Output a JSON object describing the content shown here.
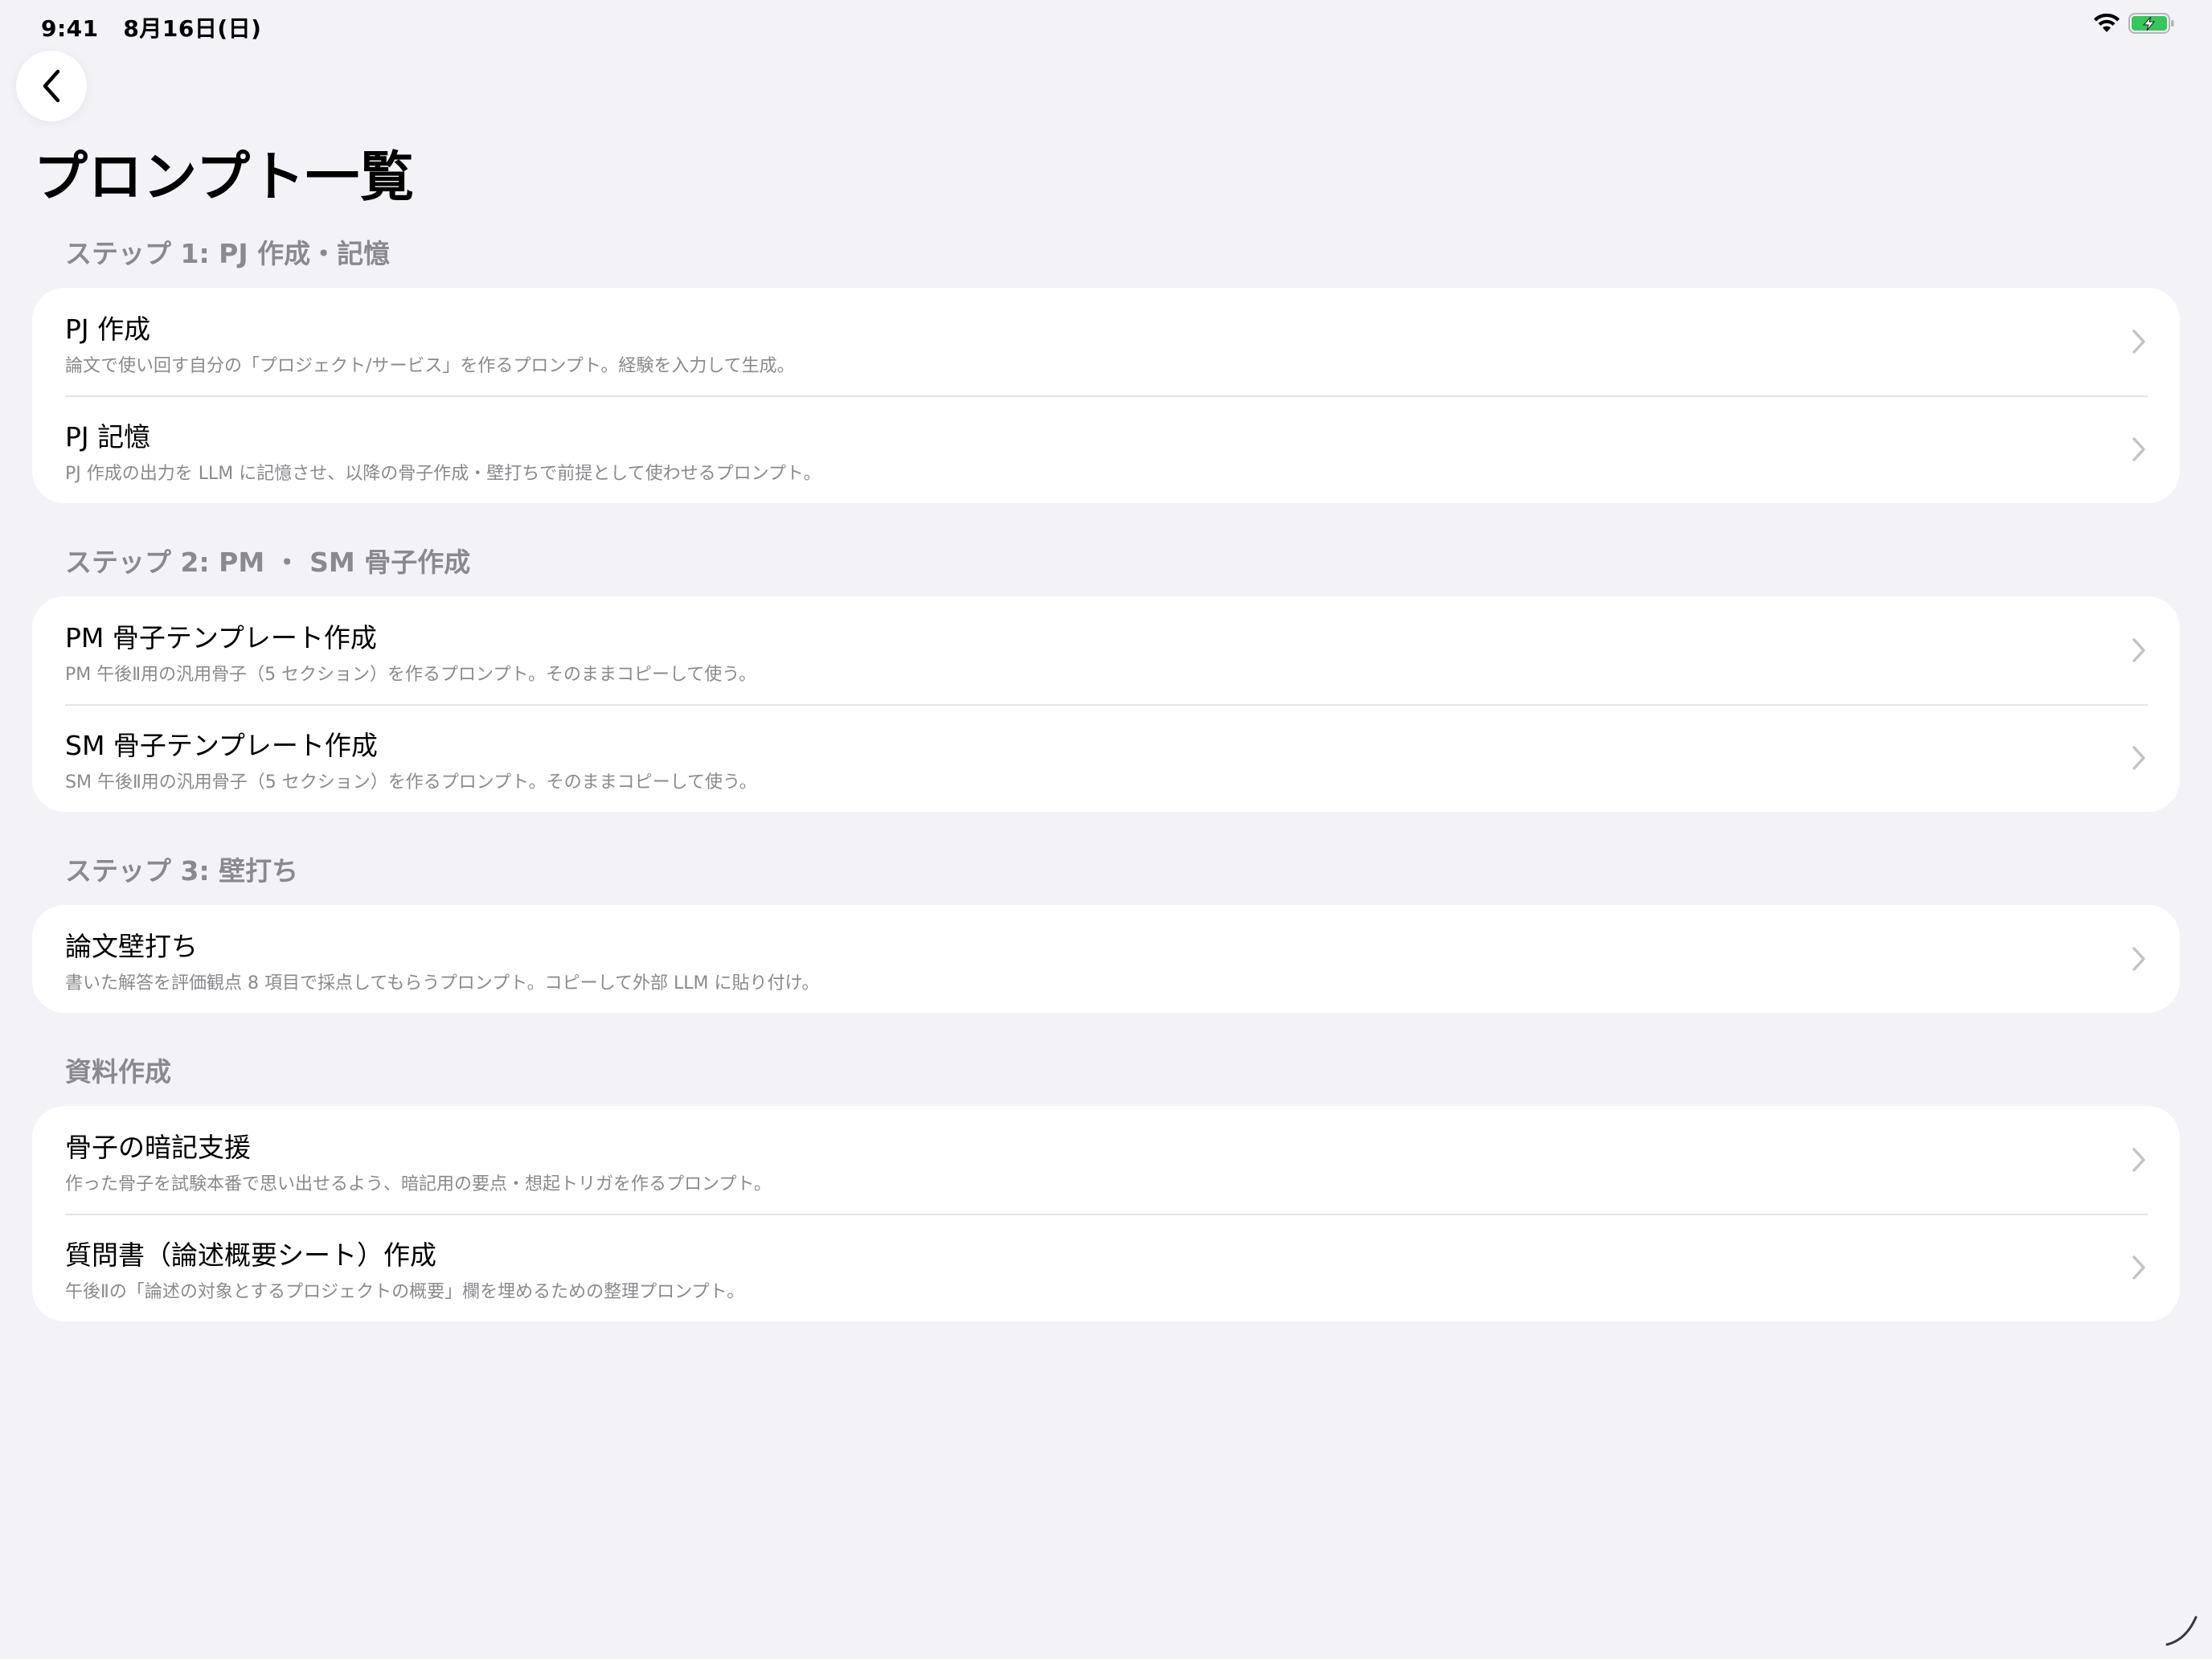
{
  "status_bar": {
    "time": "9:41",
    "date": "8月16日(日)"
  },
  "page": {
    "title": "プロンプト一覧"
  },
  "sections": [
    {
      "header": "ステップ 1: PJ 作成・記憶",
      "items": [
        {
          "title": "PJ 作成",
          "subtitle": "論文で使い回す自分の「プロジェクト/サービス」を作るプロンプト。経験を入力して生成。"
        },
        {
          "title": "PJ 記憶",
          "subtitle": "PJ 作成の出力を LLM に記憶させ、以降の骨子作成・壁打ちで前提として使わせるプロンプト。"
        }
      ]
    },
    {
      "header": "ステップ 2: PM ・ SM 骨子作成",
      "items": [
        {
          "title": "PM 骨子テンプレート作成",
          "subtitle": "PM 午後Ⅱ用の汎用骨子（5 セクション）を作るプロンプト。そのままコピーして使う。"
        },
        {
          "title": "SM 骨子テンプレート作成",
          "subtitle": "SM 午後Ⅱ用の汎用骨子（5 セクション）を作るプロンプト。そのままコピーして使う。"
        }
      ]
    },
    {
      "header": "ステップ 3: 壁打ち",
      "items": [
        {
          "title": "論文壁打ち",
          "subtitle": "書いた解答を評価観点 8 項目で採点してもらうプロンプト。コピーして外部 LLM に貼り付け。"
        }
      ]
    },
    {
      "header": "資料作成",
      "items": [
        {
          "title": "骨子の暗記支援",
          "subtitle": "作った骨子を試験本番で思い出せるよう、暗記用の要点・想起トリガを作るプロンプト。"
        },
        {
          "title": "質問書（論述概要シート）作成",
          "subtitle": "午後Ⅱの「論述の対象とするプロジェクトの概要」欄を埋めるための整理プロンプト。"
        }
      ]
    }
  ],
  "icons": {
    "back": "chevron-left-icon",
    "row_disclosure": "chevron-right-icon",
    "wifi": "wifi-icon",
    "battery": "battery-charging-icon"
  },
  "colors": {
    "background": "#f2f2f7",
    "card": "#ffffff",
    "secondary_text": "#8a8a8e",
    "chevron": "#c4c4c7",
    "battery_fill": "#34c759"
  }
}
